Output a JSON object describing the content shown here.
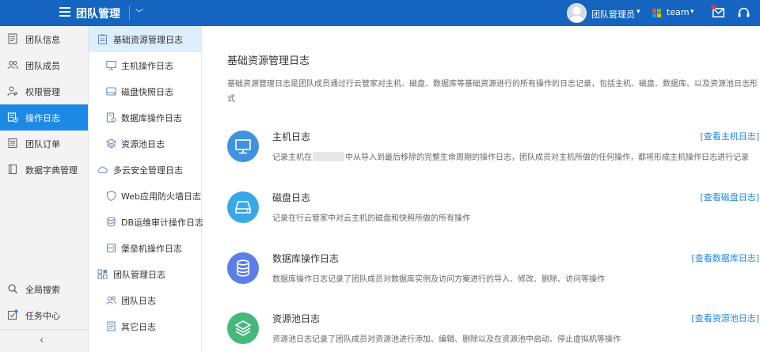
{
  "header": {
    "app_title": "团队管理",
    "user_name": "团队管理员",
    "team_name": "team"
  },
  "leftnav": {
    "items": [
      {
        "label": "团队信息",
        "icon": "document-icon"
      },
      {
        "label": "团队成员",
        "icon": "users-icon"
      },
      {
        "label": "权限管理",
        "icon": "user-key-icon"
      },
      {
        "label": "操作日志",
        "icon": "log-icon",
        "active": true
      },
      {
        "label": "团队订单",
        "icon": "order-icon"
      },
      {
        "label": "数据字典管理",
        "icon": "book-icon"
      }
    ],
    "bottom": [
      {
        "label": "全局搜索",
        "icon": "search-icon"
      },
      {
        "label": "任务中心",
        "icon": "task-icon"
      }
    ],
    "collapse_glyph": "‹"
  },
  "subnav": {
    "items": [
      {
        "label": "基础资源管理日志",
        "type": "group",
        "icon": "clipboard-icon",
        "active": true
      },
      {
        "label": "主机操作日志",
        "type": "child",
        "icon": "monitor-icon"
      },
      {
        "label": "磁盘快照日志",
        "type": "child",
        "icon": "disk-icon"
      },
      {
        "label": "数据库操作日志",
        "type": "child",
        "icon": "database-doc-icon"
      },
      {
        "label": "资源池日志",
        "type": "child",
        "icon": "layers-icon"
      },
      {
        "label": "多云安全管理日志",
        "type": "group",
        "icon": "cloud-icon"
      },
      {
        "label": "Web应用防火墙日志",
        "type": "child",
        "icon": "shield-icon"
      },
      {
        "label": "DB运维审计操作日志",
        "type": "child",
        "icon": "database-icon"
      },
      {
        "label": "堡垒机操作日志",
        "type": "child",
        "icon": "server-icon"
      },
      {
        "label": "团队管理日志",
        "type": "group",
        "icon": "grid-icon"
      },
      {
        "label": "团队日志",
        "type": "child",
        "icon": "users-icon"
      },
      {
        "label": "其它日志",
        "type": "child",
        "icon": "file-icon"
      }
    ]
  },
  "main": {
    "title": "基础资源管理日志",
    "description": "基础资源管理日志是团队成员通过行云管家对主机、磁盘、数据库等基础资源进行的所有操作的日志记录，包括主机、磁盘、数据库、以及资源池日志形式",
    "cards": [
      {
        "title": "主机日志",
        "desc_before": "记录主机在",
        "desc_after": "中从导入到最后移除的完整生命周期的操作日志，团队成员对主机所做的任何操作，都将形成主机操作日志进行记录",
        "link": "[查看主机日志]",
        "color": "#3d93e0",
        "icon": "monitor-icon"
      },
      {
        "title": "磁盘日志",
        "desc_before": "记录在行云管家中对云主机的磁盘和快照所做的所有操作",
        "desc_after": "",
        "link": "[查看磁盘日志]",
        "color": "#38a9e6",
        "icon": "disk-icon"
      },
      {
        "title": "数据库操作日志",
        "desc_before": "数据库操作日志记录了团队成员对数据库实例及访问方案进行的导入、修改、删除、访问等操作",
        "desc_after": "",
        "link": "[查看数据库日志]",
        "color": "#5b7fe6",
        "icon": "database-icon"
      },
      {
        "title": "资源池日志",
        "desc_before": "资源池日志记录了团队成员对资源池进行添加、编辑、删除以及在资源池中启动、停止虚拟机等操作",
        "desc_after": "",
        "link": "[查看资源池日志]",
        "color": "#45b87c",
        "icon": "layers-icon"
      }
    ]
  }
}
